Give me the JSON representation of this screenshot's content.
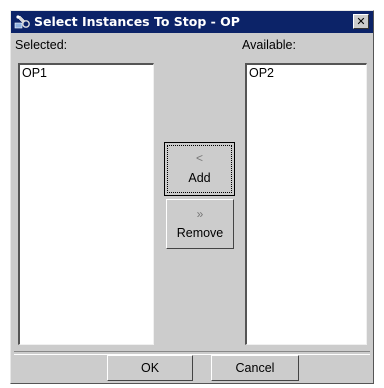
{
  "window": {
    "title": "Select Instances To Stop - OP",
    "close_glyph": "✕"
  },
  "selected": {
    "label": "Selected:",
    "items": [
      "OP1"
    ]
  },
  "available": {
    "label": "Available:",
    "items": [
      "OP2"
    ]
  },
  "buttons": {
    "add_glyph": "<",
    "add_label": "Add",
    "remove_glyph": "»",
    "remove_label": "Remove",
    "ok_label": "OK",
    "cancel_label": "Cancel"
  },
  "colors": {
    "titlebar": "#0c2368",
    "dialog_bg": "#cccccc",
    "list_bg": "#ffffff"
  },
  "icons": {
    "app": "tools-icon",
    "close": "close-icon",
    "add": "chevron-left-icon",
    "remove": "double-chevron-right-icon"
  }
}
